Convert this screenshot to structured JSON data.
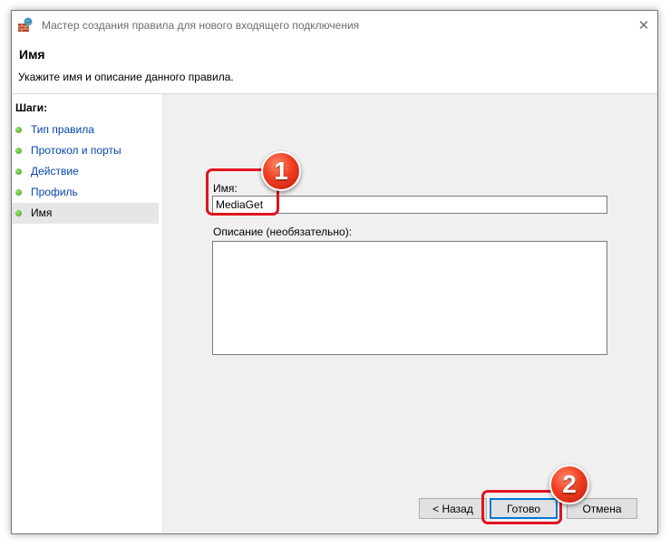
{
  "window": {
    "title": "Мастер создания правила для нового входящего подключения",
    "close_glyph": "✕"
  },
  "header": {
    "title": "Имя",
    "description": "Укажите имя и описание данного правила."
  },
  "sidebar": {
    "heading": "Шаги:",
    "steps": [
      {
        "label": "Тип правила",
        "current": false
      },
      {
        "label": "Протокол и порты",
        "current": false
      },
      {
        "label": "Действие",
        "current": false
      },
      {
        "label": "Профиль",
        "current": false
      },
      {
        "label": "Имя",
        "current": true
      }
    ]
  },
  "form": {
    "name_label": "Имя:",
    "name_value": "MediaGet",
    "description_label": "Описание (необязательно):",
    "description_value": ""
  },
  "buttons": {
    "back": "< Назад",
    "finish": "Готово",
    "cancel": "Отмена"
  },
  "annotations": {
    "badge_1": "1",
    "badge_2": "2",
    "highlight_color": "#e0141e"
  },
  "colors": {
    "link": "#0645ad",
    "step_dot": "#3c9d1e",
    "content_bg": "#f0f0f0",
    "default_button_border": "#0078d7"
  }
}
